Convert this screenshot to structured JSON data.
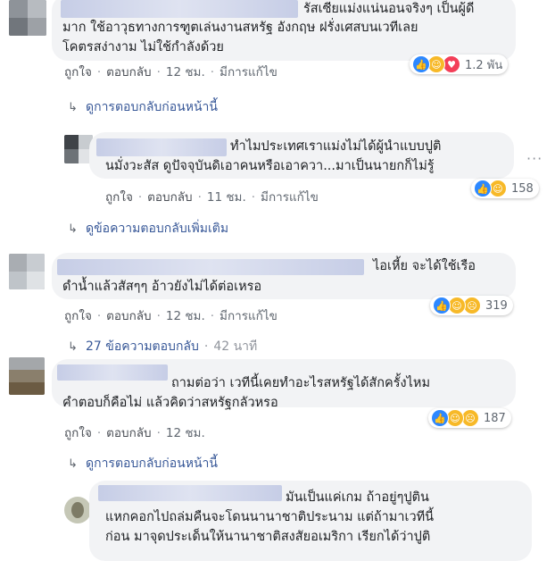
{
  "comments": [
    {
      "text_lines": [
        "รัสเซียแม่งแน่นอนจริงๆ เป็นผู้ดี",
        "มาก ใช้อาวุธทางการฑูตเล่นงานสหรัฐ อังกฤษ ฝรั่งเศสบนเวทีเลย",
        "โคตรสง่างาม ไม่ใช้กำลังด้วย"
      ],
      "like": "ถูกใจ",
      "reply": "ตอบกลับ",
      "time": "12 ชม.",
      "edited": "มีการแก้ไข",
      "reaction_count": "1.2 พัน",
      "reply_link": "ดูการตอบกลับก่อนหน้านี้"
    },
    {
      "text_lines": [
        "ทำไมประเทศเราแม่งไม่ได้ผู้นำแบบปูติ",
        "นมั่งวะสัส ดูปัจจุบันดิเอาคนหรือเอาควา...มาเป็นนายกก็ไม่รู้"
      ],
      "like": "ถูกใจ",
      "reply": "ตอบกลับ",
      "time": "11 ชม.",
      "edited": "มีการแก้ไข",
      "reaction_count": "158",
      "reply_link": "ดูข้อความตอบกลับเพิ่มเติม"
    },
    {
      "text_lines": [
        "ไอเหี้ย จะได้ใช้เรือ",
        "ดำน้ำแล้วสัสๆๆ อ้าวยังไม่ได้ต่อเหรอ"
      ],
      "like": "ถูกใจ",
      "reply": "ตอบกลับ",
      "time": "12 ชม.",
      "edited": "มีการแก้ไข",
      "reaction_count": "319",
      "reply_link": "27 ข้อความตอบกลับ",
      "reply_link_time": "42 นาที"
    },
    {
      "text_lines": [
        "ถามต่อว่า เวทีนี้เคยทำอะไรสหรัฐได้สักครั้งไหม",
        "คำตอบก็คือไม่ แล้วคิดว่าสหรัฐกลัวหรอ"
      ],
      "like": "ถูกใจ",
      "reply": "ตอบกลับ",
      "time": "12 ชม.",
      "reaction_count": "187",
      "reply_link": "ดูการตอบกลับก่อนหน้านี้"
    },
    {
      "text_lines": [
        "มันเป็นแค่เกม ถ้าอยู่ๆปูติน",
        "แหกคอกไปถล่มคืนจะโดนนานาชาติประนาม แต่ถ้ามาเวทีนี้",
        "ก่อน มาจุดประเด็นให้นานาชาติสงสัยอเมริกา เรียกได้ว่าปูติ"
      ]
    }
  ],
  "icons": {
    "like": "like-icon",
    "haha": "haha-icon",
    "sad": "sad-icon",
    "love": "love-icon",
    "reply_arrow": "reply-arrow-icon",
    "more": "more-options-icon"
  },
  "colors": {
    "link": "#385898",
    "bubble": "#f2f3f5",
    "like_blue": "#2d88ff",
    "emoji_yellow": "#f7b928",
    "love_red": "#f33e58"
  }
}
